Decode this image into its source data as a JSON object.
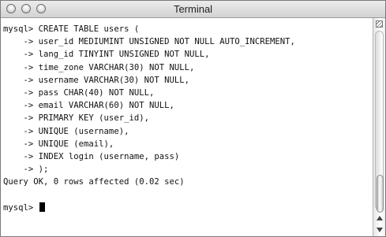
{
  "window": {
    "title": "Terminal"
  },
  "terminal": {
    "lines": [
      "mysql> CREATE TABLE users (",
      "    -> user_id MEDIUMINT UNSIGNED NOT NULL AUTO_INCREMENT,",
      "    -> lang_id TINYINT UNSIGNED NOT NULL,",
      "    -> time_zone VARCHAR(30) NOT NULL,",
      "    -> username VARCHAR(30) NOT NULL,",
      "    -> pass CHAR(40) NOT NULL,",
      "    -> email VARCHAR(60) NOT NULL,",
      "    -> PRIMARY KEY (user_id),",
      "    -> UNIQUE (username),",
      "    -> UNIQUE (email),",
      "    -> INDEX login (username, pass)",
      "    -> );",
      "Query OK, 0 rows affected (0.02 sec)",
      "",
      "mysql> "
    ]
  },
  "icons": {
    "close": "close-button-icon",
    "minimize": "minimize-button-icon",
    "zoom": "zoom-button-icon",
    "split": "split-view-icon",
    "scroll_up": "arrow-up-icon",
    "scroll_down": "arrow-down-icon"
  },
  "scroll": {
    "position_fraction": 0.96
  }
}
